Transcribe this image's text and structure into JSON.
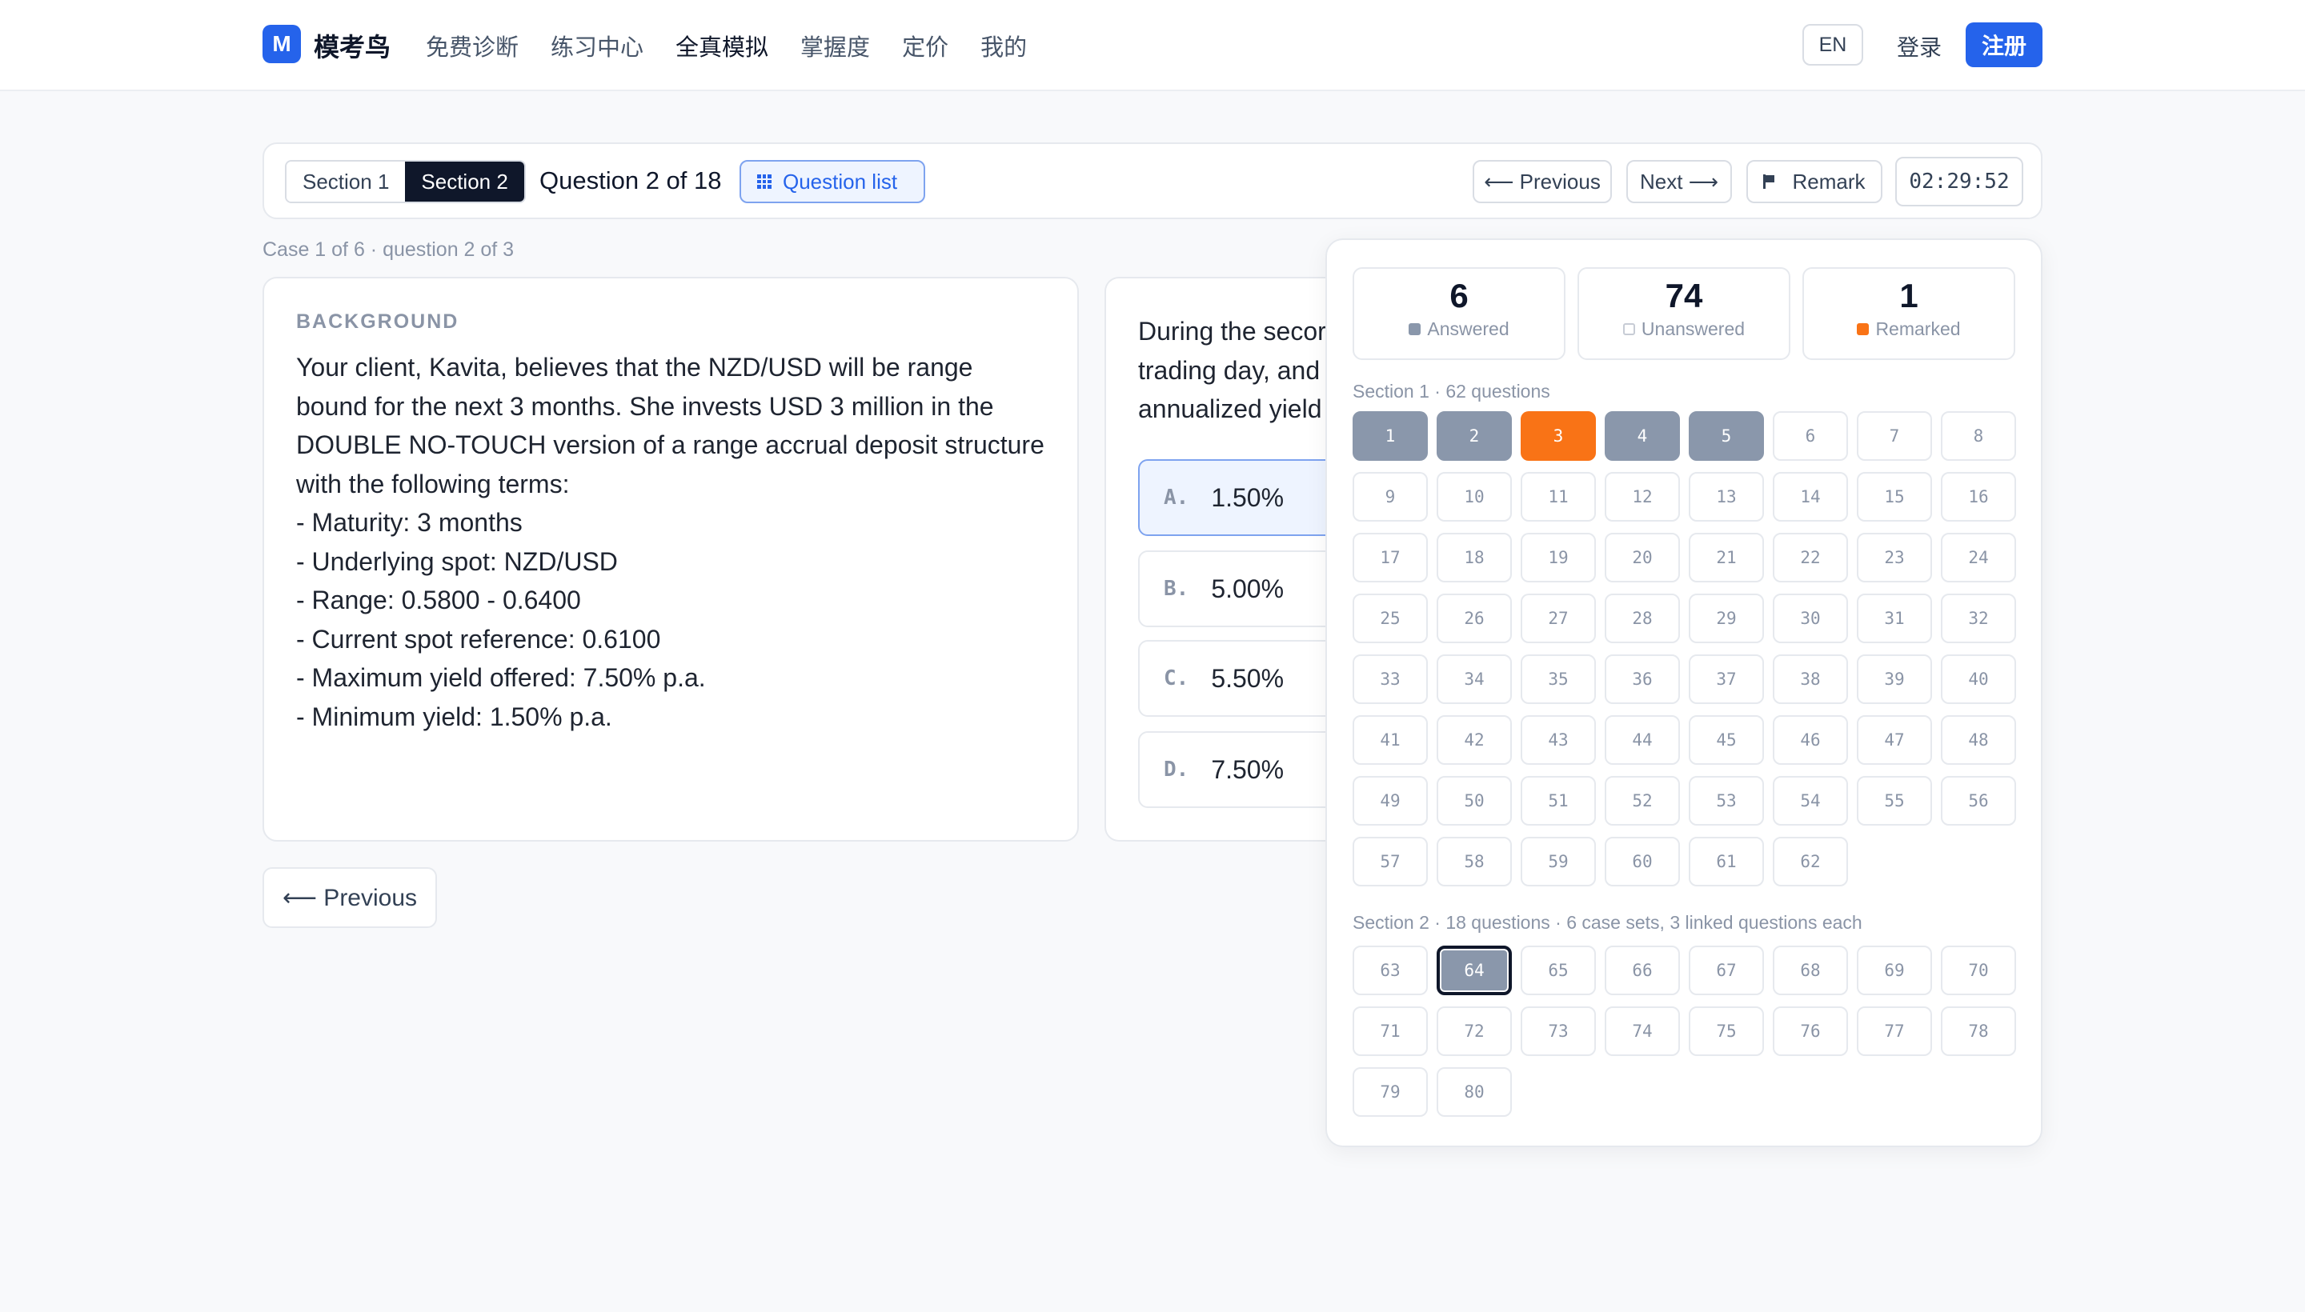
{
  "header": {
    "logo_letter": "M",
    "brand": "模考鸟",
    "nav": [
      "免费诊断",
      "练习中心",
      "全真模拟",
      "掌握度",
      "定价",
      "我的"
    ],
    "lang": "EN",
    "login": "登录",
    "register": "注册"
  },
  "toolbar": {
    "section1": "Section 1",
    "section2": "Section 2",
    "question_count": "Question 2 of 18",
    "question_list": "Question list",
    "previous": "⟵ Previous",
    "next": "Next ⟶",
    "remark": "Remark",
    "timer": "02:29:52"
  },
  "case_info": "Case 1 of 6 · question 2 of 3",
  "background": {
    "label": "BACKGROUND",
    "lines": [
      "Your client, Kavita, believes that the NZD/USD will be range",
      "bound for the next 3 months. She invests USD 3 million in the",
      "DOUBLE NO-TOUCH version of a range accrual deposit structure",
      "with the following terms:",
      "- Maturity: 3 months",
      "- Underlying spot: NZD/USD",
      "- Range: 0.5800 - 0.6400",
      "- Current spot reference: 0.6100",
      "- Maximum yield offered: 7.50% p.a.",
      "- Minimum yield: 1.50% p.a."
    ]
  },
  "question": {
    "stem_lines": [
      "During the secor",
      "trading day, and",
      "annualized yield"
    ],
    "options": [
      {
        "letter": "A.",
        "text": "1.50%"
      },
      {
        "letter": "B.",
        "text": "5.00%"
      },
      {
        "letter": "C.",
        "text": "5.50%"
      },
      {
        "letter": "D.",
        "text": "7.50%"
      }
    ],
    "selected": "A"
  },
  "bottom_previous": "⟵ Previous",
  "panel": {
    "stats": [
      {
        "value": "6",
        "label": "Answered",
        "color": "#8a97ab"
      },
      {
        "value": "74",
        "label": "Unanswered",
        "color": "#ffffff"
      },
      {
        "value": "1",
        "label": "Remarked",
        "color": "#f97316"
      }
    ],
    "section1_title": "Section 1 · 62 questions",
    "section2_title": "Section 2 · 18 questions · 6 case sets, 3 linked questions each",
    "answered": [
      1,
      2,
      4,
      5,
      64
    ],
    "remarked": [
      3
    ],
    "current": 64
  },
  "colors": {
    "primary": "#2563eb",
    "dark": "#0f172a",
    "answered": "#8a97ab",
    "remarked": "#f97316"
  }
}
